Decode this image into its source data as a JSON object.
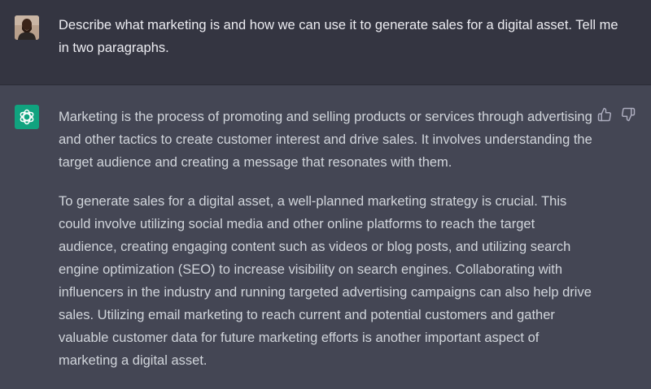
{
  "conversation": {
    "user_message": {
      "text": "Describe what marketing is and how we can use it to generate sales for a digital asset. Tell me in two paragraphs.",
      "avatar_icon": "user-photo-avatar"
    },
    "assistant_message": {
      "avatar_icon": "openai-logo-icon",
      "paragraphs": [
        "Marketing is the process of promoting and selling products or services through advertising and other tactics to create customer interest and drive sales. It involves understanding the target audience and creating a message that resonates with them.",
        "To generate sales for a digital asset, a well-planned marketing strategy is crucial. This could involve utilizing social media and other online platforms to reach the target audience, creating engaging content such as videos or blog posts, and utilizing search engine optimization (SEO) to increase visibility on search engines. Collaborating with influencers in the industry and running targeted advertising campaigns can also help drive sales. Utilizing email marketing to reach current and potential customers and gather valuable customer data for future marketing efforts is another important aspect of marketing a digital asset."
      ],
      "feedback_icons": [
        "thumbs-up-icon",
        "thumbs-down-icon"
      ]
    }
  },
  "colors": {
    "user_row_bg": "#343541",
    "assistant_row_bg": "#444654",
    "bot_avatar_bg": "#10a37f",
    "text": "#ececf1"
  }
}
